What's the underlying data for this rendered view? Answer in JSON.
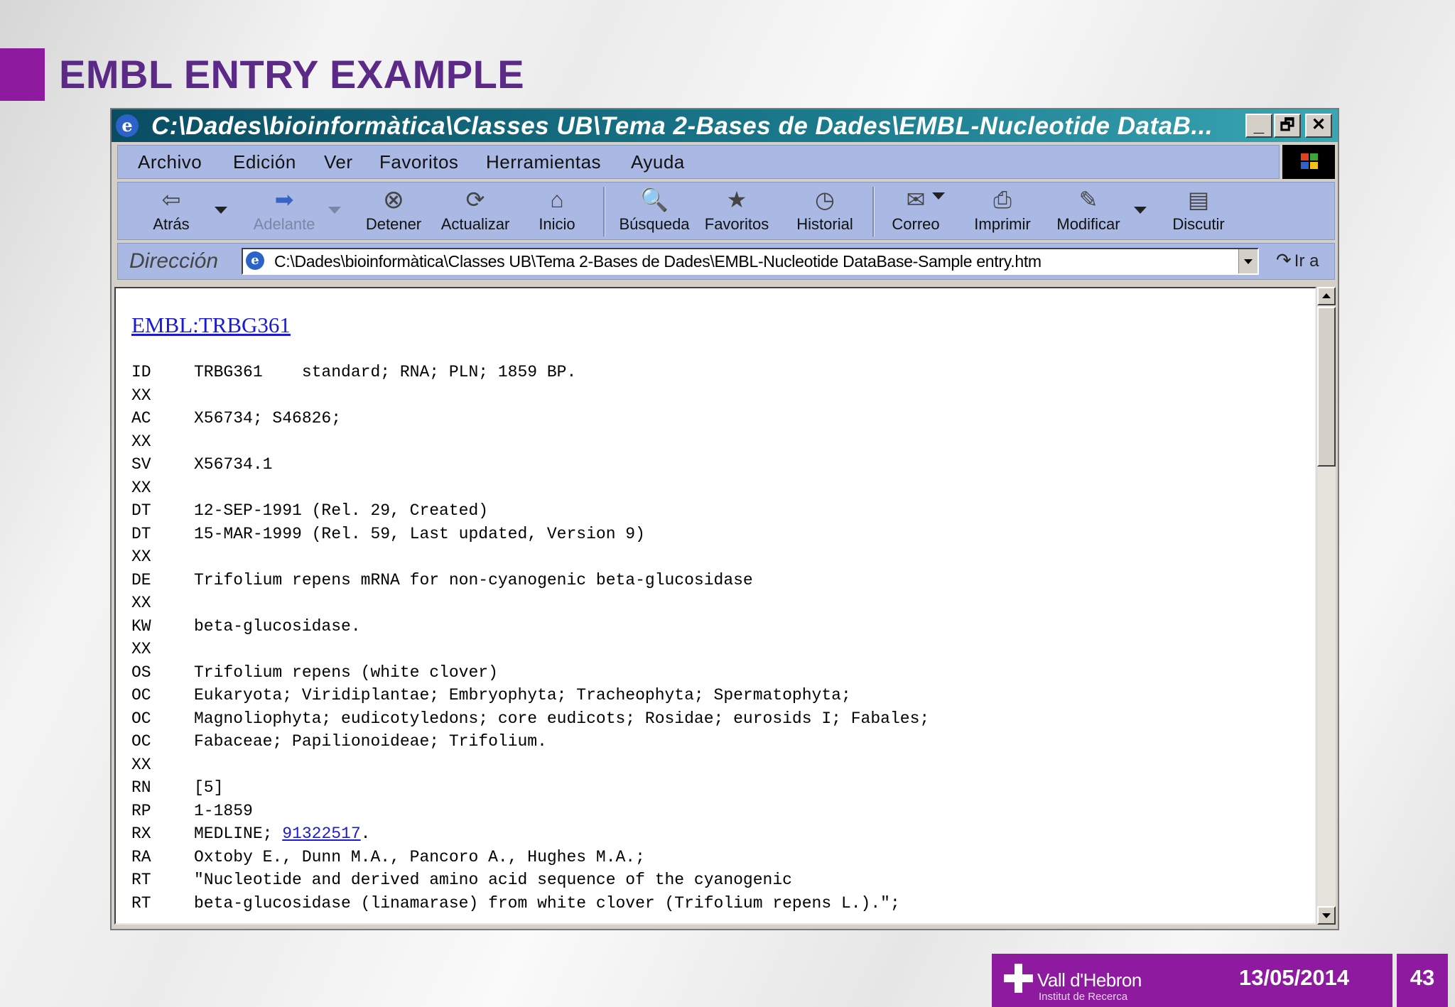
{
  "slide": {
    "title": "EMBL ENTRY EXAMPLE",
    "footer": {
      "org_name": "Vall d'Hebron",
      "org_sub": "Institut de Recerca",
      "date": "13/05/2014",
      "page": "43"
    }
  },
  "window": {
    "title": "C:\\Dades\\bioinformàtica\\Classes UB\\Tema 2-Bases de Dades\\EMBL-Nucleotide DataB...",
    "minimize": "_",
    "restore": "🗗",
    "close": "✕"
  },
  "menu": [
    "Archivo",
    "Edición",
    "Ver",
    "Favoritos",
    "Herramientas",
    "Ayuda"
  ],
  "toolbar": {
    "back": "Atrás",
    "forward": "Adelante",
    "stop": "Detener",
    "refresh": "Actualizar",
    "home": "Inicio",
    "search": "Búsqueda",
    "favorites": "Favoritos",
    "history": "Historial",
    "mail": "Correo",
    "print": "Imprimir",
    "edit": "Modificar",
    "discuss": "Discutir"
  },
  "address": {
    "label": "Dirección",
    "value": "C:\\Dades\\bioinformàtica\\Classes UB\\Tema 2-Bases de Dades\\EMBL-Nucleotide DataBase-Sample entry.htm",
    "go": "Ir a"
  },
  "entry": {
    "link": "EMBL:TRBG361",
    "lines": [
      [
        "ID",
        "TRBG361    standard; RNA; PLN; 1859 BP."
      ],
      [
        "XX",
        ""
      ],
      [
        "AC",
        "X56734; S46826;"
      ],
      [
        "XX",
        ""
      ],
      [
        "SV",
        "X56734.1"
      ],
      [
        "XX",
        ""
      ],
      [
        "DT",
        "12-SEP-1991 (Rel. 29, Created)"
      ],
      [
        "DT",
        "15-MAR-1999 (Rel. 59, Last updated, Version 9)"
      ],
      [
        "XX",
        ""
      ],
      [
        "DE",
        "Trifolium repens mRNA for non-cyanogenic beta-glucosidase"
      ],
      [
        "XX",
        ""
      ],
      [
        "KW",
        "beta-glucosidase."
      ],
      [
        "XX",
        ""
      ],
      [
        "OS",
        "Trifolium repens (white clover)"
      ],
      [
        "OC",
        "Eukaryota; Viridiplantae; Embryophyta; Tracheophyta; Spermatophyta;"
      ],
      [
        "OC",
        "Magnoliophyta; eudicotyledons; core eudicots; Rosidae; eurosids I; Fabales;"
      ],
      [
        "OC",
        "Fabaceae; Papilionoideae; Trifolium."
      ],
      [
        "XX",
        ""
      ],
      [
        "RN",
        "[5]"
      ],
      [
        "RP",
        "1-1859"
      ],
      [
        "RX",
        "MEDLINE; "
      ],
      [
        "RA",
        "Oxtoby E., Dunn M.A., Pancoro A., Hughes M.A.;"
      ],
      [
        "RT",
        "\"Nucleotide and derived amino acid sequence of the cyanogenic"
      ],
      [
        "RT",
        "beta-glucosidase (linamarase) from white clover (Trifolium repens L.).\";"
      ]
    ],
    "medline_link": "91322517",
    "medline_tail": "."
  }
}
